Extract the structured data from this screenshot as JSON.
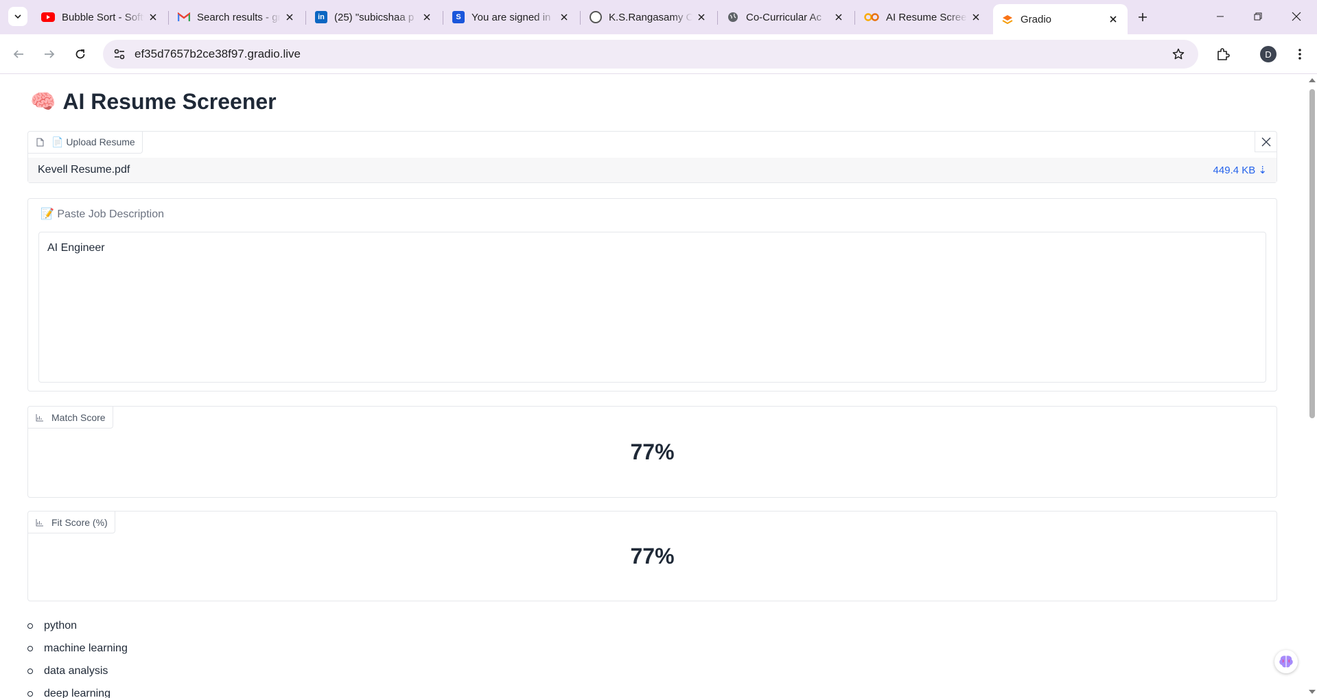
{
  "browser": {
    "tabs": [
      {
        "title": "Bubble Sort - Software",
        "icon": "youtube-icon",
        "color": "#ff0000"
      },
      {
        "title": "Search results - gmail",
        "icon": "gmail-icon",
        "color": "#ea4335"
      },
      {
        "title": "(25) \"subicshaa p",
        "icon": "linkedin-icon",
        "color": "#0a66c2"
      },
      {
        "title": "You are signed in",
        "icon": "s-icon",
        "color": "#1a56db"
      },
      {
        "title": "K.S.Rangasamy C",
        "icon": "college-icon",
        "color": "#555555"
      },
      {
        "title": "Co-Curricular Ac",
        "icon": "globe-icon",
        "color": "#5f6368"
      },
      {
        "title": "AI Resume Scree",
        "icon": "colab-icon",
        "color": "#f9ab00"
      },
      {
        "title": "Gradio",
        "icon": "gradio-icon",
        "color": "#f97316",
        "active": true
      }
    ],
    "url": "ef35d7657b2ce38f97.gradio.live",
    "profile_initial": "D"
  },
  "app": {
    "title": "AI Resume Screener",
    "title_emoji": "🧠",
    "upload": {
      "label": "📄 Upload Resume",
      "file_name": "Kevell Resume.pdf",
      "file_size": "449.4 KB ⇣"
    },
    "job_description": {
      "label": "📝 Paste Job Description",
      "value": "AI Engineer"
    },
    "match_score": {
      "label": "Match Score",
      "value": "77%"
    },
    "fit_score": {
      "label": "Fit Score (%)",
      "value": "77%"
    },
    "skills": [
      "python",
      "machine learning",
      "data analysis",
      "deep learning"
    ]
  },
  "colors": {
    "accent_link": "#2563eb",
    "chrome_tabstrip": "#ece3f4",
    "omnibox": "#f1ebf6"
  }
}
